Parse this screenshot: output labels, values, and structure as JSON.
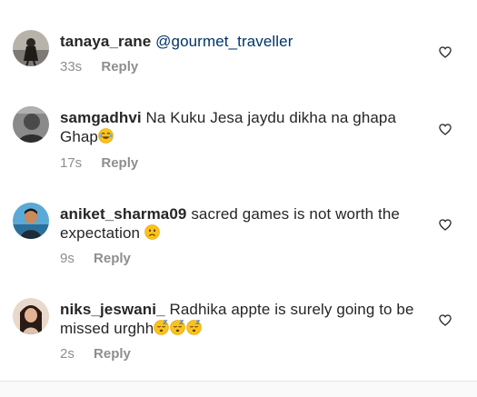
{
  "comments": [
    {
      "username": "tanaya_rane",
      "mention": "@gourmet_traveller",
      "text": "",
      "time": "33s",
      "reply": "Reply"
    },
    {
      "username": "samgadhvi",
      "text": "Na Kuku Jesa jaydu dikha na ghapa Ghap",
      "emojis": [
        "face-with-tears-of-joy"
      ],
      "time": "17s",
      "reply": "Reply"
    },
    {
      "username": "aniket_sharma09",
      "text": "sacred games is not worth the expectation",
      "emojis": [
        "slightly-frowning-face"
      ],
      "time": "9s",
      "reply": "Reply"
    },
    {
      "username": "niks_jeswani_",
      "text": "Radhika appte is surely going to be missed urghh",
      "emojis": [
        "sleeping-face",
        "sleeping-face",
        "sleeping-face"
      ],
      "time": "2s",
      "reply": "Reply"
    }
  ],
  "icons": {
    "like": "heart-outline-icon"
  },
  "colors": {
    "text": "#262626",
    "muted": "#8e8e8e",
    "mention": "#003569",
    "emoji": "#fcc21b"
  }
}
